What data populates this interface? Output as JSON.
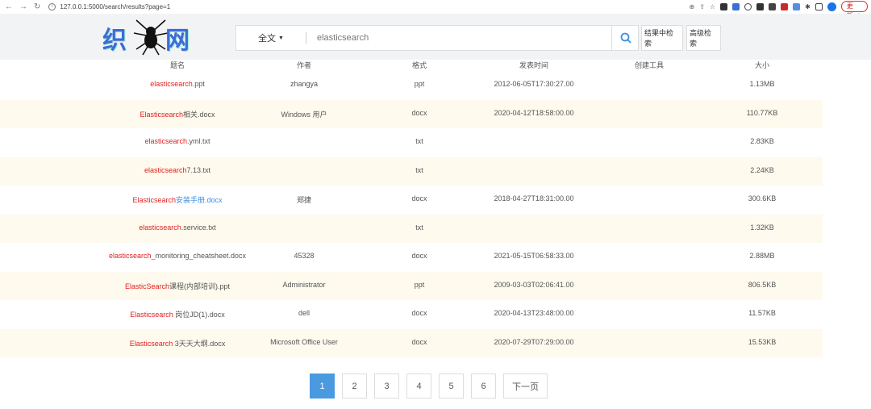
{
  "browser": {
    "url": "127.0.0.1:5000/search/results?page=1",
    "update_label": "更新"
  },
  "header": {
    "logo_left": "织",
    "logo_right": "网",
    "scope_label": "全文",
    "query": "elasticsearch",
    "search_in_results_label": "结果中检索",
    "advanced_search_label": "高级检索"
  },
  "table": {
    "columns": [
      "题名",
      "作者",
      "格式",
      "发表时间",
      "创建工具",
      "大小"
    ],
    "rows": [
      {
        "title_parts": [
          {
            "text": "elasticsearch",
            "style": "red"
          },
          {
            "text": ".ppt",
            "style": "plain"
          }
        ],
        "author": "zhangya",
        "format": "ppt",
        "date": "2012-06-05T17:30:27.00",
        "tool": "",
        "size": "1.13MB"
      },
      {
        "title_parts": [
          {
            "text": "Elasticsearch",
            "style": "red"
          },
          {
            "text": "相关.docx",
            "style": "plain"
          }
        ],
        "author": "Windows 用户",
        "format": "docx",
        "date": "2020-04-12T18:58:00.00",
        "tool": "",
        "size": "110.77KB"
      },
      {
        "title_parts": [
          {
            "text": "elasticsearch",
            "style": "red"
          },
          {
            "text": ".yml.txt",
            "style": "plain"
          }
        ],
        "author": "",
        "format": "txt",
        "date": "",
        "tool": "",
        "size": "2.83KB"
      },
      {
        "title_parts": [
          {
            "text": "elasticsearch",
            "style": "red"
          },
          {
            "text": "7.13.txt",
            "style": "plain"
          }
        ],
        "author": "",
        "format": "txt",
        "date": "",
        "tool": "",
        "size": "2.24KB"
      },
      {
        "title_parts": [
          {
            "text": "Elasticsearch",
            "style": "red"
          },
          {
            "text": "安装手册.docx",
            "style": "blue"
          }
        ],
        "author": "郑捷",
        "format": "docx",
        "date": "2018-04-27T18:31:00.00",
        "tool": "",
        "size": "300.6KB"
      },
      {
        "title_parts": [
          {
            "text": "elasticsearch",
            "style": "red"
          },
          {
            "text": ".service.txt",
            "style": "plain"
          }
        ],
        "author": "",
        "format": "txt",
        "date": "",
        "tool": "",
        "size": "1.32KB"
      },
      {
        "title_parts": [
          {
            "text": "elasticsearch",
            "style": "red"
          },
          {
            "text": "_monitoring_cheatsheet.docx",
            "style": "plain"
          }
        ],
        "author": "45328",
        "format": "docx",
        "date": "2021-05-15T06:58:33.00",
        "tool": "",
        "size": "2.88MB"
      },
      {
        "title_parts": [
          {
            "text": "ElasticSearch",
            "style": "red"
          },
          {
            "text": "课程(内部培训).ppt",
            "style": "plain"
          }
        ],
        "author": "Administrator",
        "format": "ppt",
        "date": "2009-03-03T02:06:41.00",
        "tool": "",
        "size": "806.5KB"
      },
      {
        "title_parts": [
          {
            "text": "Elasticsearch",
            "style": "red"
          },
          {
            "text": " 岗位JD(1).docx",
            "style": "plain"
          }
        ],
        "author": "dell",
        "format": "docx",
        "date": "2020-04-13T23:48:00.00",
        "tool": "",
        "size": "11.57KB"
      },
      {
        "title_parts": [
          {
            "text": "Elasticsearch",
            "style": "red"
          },
          {
            "text": " 3天天大纲.docx",
            "style": "plain"
          }
        ],
        "author": "Microsoft Office User",
        "format": "docx",
        "date": "2020-07-29T07:29:00.00",
        "tool": "",
        "size": "15.53KB"
      }
    ]
  },
  "pagination": {
    "pages": [
      "1",
      "2",
      "3",
      "4",
      "5",
      "6"
    ],
    "current": "1",
    "next_label": "下一页"
  },
  "colors": {
    "accent": "#4a9ae0",
    "highlight": "#e02020",
    "row_alt": "#fffaee",
    "header_bg": "#f2f3f5"
  }
}
